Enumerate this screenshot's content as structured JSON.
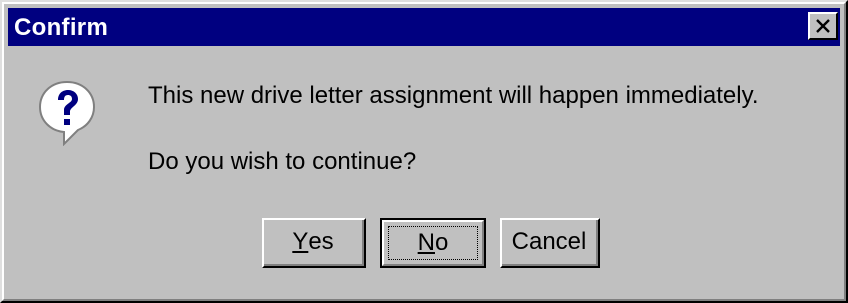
{
  "window": {
    "title": "Confirm",
    "close_label": "Close"
  },
  "dialog": {
    "icon": "question-icon",
    "message": "This new drive letter assignment will happen immediately.",
    "prompt": "Do you wish to continue?"
  },
  "buttons": {
    "yes": {
      "mnemonic": "Y",
      "rest": "es"
    },
    "no": {
      "mnemonic": "N",
      "rest": "o"
    },
    "cancel": {
      "label": "Cancel"
    }
  },
  "colors": {
    "title_bar": "#000080",
    "face": "#c0c0c0",
    "icon_blue": "#000080"
  }
}
